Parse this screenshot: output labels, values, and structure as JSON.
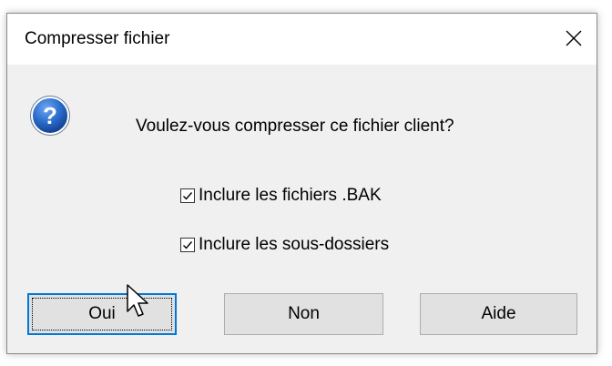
{
  "dialog": {
    "title": "Compresser fichier",
    "message": "Voulez-vous compresser ce fichier client?",
    "icon": "question-icon",
    "options": [
      {
        "label": "Inclure les fichiers .BAK",
        "checked": true
      },
      {
        "label": "Inclure les sous-dossiers",
        "checked": true
      }
    ],
    "buttons": {
      "yes": "Oui",
      "no": "Non",
      "help": "Aide"
    }
  },
  "colors": {
    "accent": "#0078d7",
    "icon_blue": "#1f5fb4",
    "dialog_bg": "#f0f0f0",
    "button_bg": "#e1e1e1"
  }
}
